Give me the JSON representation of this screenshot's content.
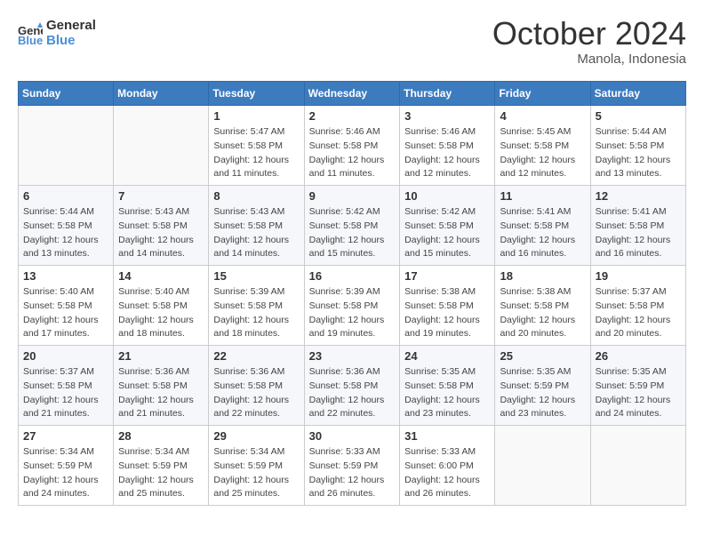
{
  "header": {
    "logo_line1": "General",
    "logo_line2": "Blue",
    "month": "October 2024",
    "location": "Manola, Indonesia"
  },
  "days_of_week": [
    "Sunday",
    "Monday",
    "Tuesday",
    "Wednesday",
    "Thursday",
    "Friday",
    "Saturday"
  ],
  "weeks": [
    [
      {
        "day": "",
        "info": ""
      },
      {
        "day": "",
        "info": ""
      },
      {
        "day": "1",
        "info": "Sunrise: 5:47 AM\nSunset: 5:58 PM\nDaylight: 12 hours\nand 11 minutes."
      },
      {
        "day": "2",
        "info": "Sunrise: 5:46 AM\nSunset: 5:58 PM\nDaylight: 12 hours\nand 11 minutes."
      },
      {
        "day": "3",
        "info": "Sunrise: 5:46 AM\nSunset: 5:58 PM\nDaylight: 12 hours\nand 12 minutes."
      },
      {
        "day": "4",
        "info": "Sunrise: 5:45 AM\nSunset: 5:58 PM\nDaylight: 12 hours\nand 12 minutes."
      },
      {
        "day": "5",
        "info": "Sunrise: 5:44 AM\nSunset: 5:58 PM\nDaylight: 12 hours\nand 13 minutes."
      }
    ],
    [
      {
        "day": "6",
        "info": "Sunrise: 5:44 AM\nSunset: 5:58 PM\nDaylight: 12 hours\nand 13 minutes."
      },
      {
        "day": "7",
        "info": "Sunrise: 5:43 AM\nSunset: 5:58 PM\nDaylight: 12 hours\nand 14 minutes."
      },
      {
        "day": "8",
        "info": "Sunrise: 5:43 AM\nSunset: 5:58 PM\nDaylight: 12 hours\nand 14 minutes."
      },
      {
        "day": "9",
        "info": "Sunrise: 5:42 AM\nSunset: 5:58 PM\nDaylight: 12 hours\nand 15 minutes."
      },
      {
        "day": "10",
        "info": "Sunrise: 5:42 AM\nSunset: 5:58 PM\nDaylight: 12 hours\nand 15 minutes."
      },
      {
        "day": "11",
        "info": "Sunrise: 5:41 AM\nSunset: 5:58 PM\nDaylight: 12 hours\nand 16 minutes."
      },
      {
        "day": "12",
        "info": "Sunrise: 5:41 AM\nSunset: 5:58 PM\nDaylight: 12 hours\nand 16 minutes."
      }
    ],
    [
      {
        "day": "13",
        "info": "Sunrise: 5:40 AM\nSunset: 5:58 PM\nDaylight: 12 hours\nand 17 minutes."
      },
      {
        "day": "14",
        "info": "Sunrise: 5:40 AM\nSunset: 5:58 PM\nDaylight: 12 hours\nand 18 minutes."
      },
      {
        "day": "15",
        "info": "Sunrise: 5:39 AM\nSunset: 5:58 PM\nDaylight: 12 hours\nand 18 minutes."
      },
      {
        "day": "16",
        "info": "Sunrise: 5:39 AM\nSunset: 5:58 PM\nDaylight: 12 hours\nand 19 minutes."
      },
      {
        "day": "17",
        "info": "Sunrise: 5:38 AM\nSunset: 5:58 PM\nDaylight: 12 hours\nand 19 minutes."
      },
      {
        "day": "18",
        "info": "Sunrise: 5:38 AM\nSunset: 5:58 PM\nDaylight: 12 hours\nand 20 minutes."
      },
      {
        "day": "19",
        "info": "Sunrise: 5:37 AM\nSunset: 5:58 PM\nDaylight: 12 hours\nand 20 minutes."
      }
    ],
    [
      {
        "day": "20",
        "info": "Sunrise: 5:37 AM\nSunset: 5:58 PM\nDaylight: 12 hours\nand 21 minutes."
      },
      {
        "day": "21",
        "info": "Sunrise: 5:36 AM\nSunset: 5:58 PM\nDaylight: 12 hours\nand 21 minutes."
      },
      {
        "day": "22",
        "info": "Sunrise: 5:36 AM\nSunset: 5:58 PM\nDaylight: 12 hours\nand 22 minutes."
      },
      {
        "day": "23",
        "info": "Sunrise: 5:36 AM\nSunset: 5:58 PM\nDaylight: 12 hours\nand 22 minutes."
      },
      {
        "day": "24",
        "info": "Sunrise: 5:35 AM\nSunset: 5:58 PM\nDaylight: 12 hours\nand 23 minutes."
      },
      {
        "day": "25",
        "info": "Sunrise: 5:35 AM\nSunset: 5:59 PM\nDaylight: 12 hours\nand 23 minutes."
      },
      {
        "day": "26",
        "info": "Sunrise: 5:35 AM\nSunset: 5:59 PM\nDaylight: 12 hours\nand 24 minutes."
      }
    ],
    [
      {
        "day": "27",
        "info": "Sunrise: 5:34 AM\nSunset: 5:59 PM\nDaylight: 12 hours\nand 24 minutes."
      },
      {
        "day": "28",
        "info": "Sunrise: 5:34 AM\nSunset: 5:59 PM\nDaylight: 12 hours\nand 25 minutes."
      },
      {
        "day": "29",
        "info": "Sunrise: 5:34 AM\nSunset: 5:59 PM\nDaylight: 12 hours\nand 25 minutes."
      },
      {
        "day": "30",
        "info": "Sunrise: 5:33 AM\nSunset: 5:59 PM\nDaylight: 12 hours\nand 26 minutes."
      },
      {
        "day": "31",
        "info": "Sunrise: 5:33 AM\nSunset: 6:00 PM\nDaylight: 12 hours\nand 26 minutes."
      },
      {
        "day": "",
        "info": ""
      },
      {
        "day": "",
        "info": ""
      }
    ]
  ]
}
